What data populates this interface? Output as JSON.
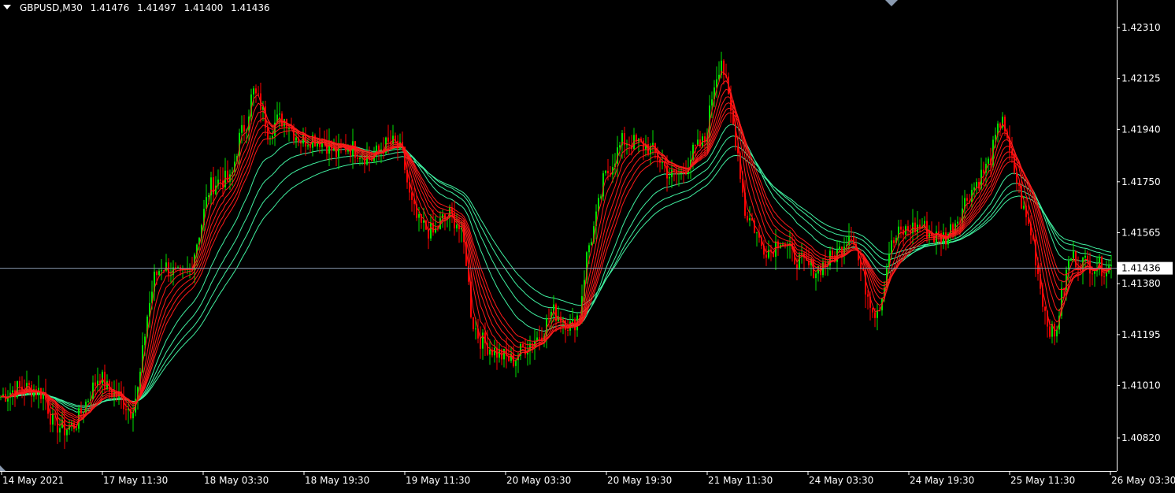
{
  "header": {
    "symbol": "GBPUSD,M30",
    "open": "1.41476",
    "high": "1.41497",
    "low": "1.41400",
    "close": "1.41436"
  },
  "colors": {
    "background": "#000000",
    "axis": "#ffffff",
    "bull_candle": "#00e000",
    "bear_candle": "#ff0000",
    "fast_ma": "#ff1a1a",
    "slow_ma": "#40f0a0",
    "current_price_line": "#8a9ab0"
  },
  "chart_data": {
    "type": "candlestick",
    "y_range": [
      1.407,
      1.4241
    ],
    "y_ticks": [
      "1.42310",
      "1.42125",
      "1.41940",
      "1.41750",
      "1.41565",
      "1.41380",
      "1.41195",
      "1.41010",
      "1.40820"
    ],
    "x_ticks": [
      "14 May 2021",
      "17 May 11:30",
      "18 May 03:30",
      "18 May 19:30",
      "19 May 11:30",
      "20 May 03:30",
      "20 May 19:30",
      "21 May 11:30",
      "24 May 03:30",
      "24 May 19:30",
      "25 May 11:30",
      "26 May 03:30"
    ],
    "current_price": "1.41436",
    "price_path": [
      [
        0,
        1.4097
      ],
      [
        20,
        1.41
      ],
      [
        40,
        1.41
      ],
      [
        55,
        1.4098
      ],
      [
        65,
        1.4088
      ],
      [
        80,
        1.4085
      ],
      [
        95,
        1.4087
      ],
      [
        110,
        1.4096
      ],
      [
        125,
        1.4105
      ],
      [
        135,
        1.41
      ],
      [
        150,
        1.4097
      ],
      [
        165,
        1.4092
      ],
      [
        175,
        1.41
      ],
      [
        185,
        1.4125
      ],
      [
        195,
        1.414
      ],
      [
        205,
        1.4145
      ],
      [
        215,
        1.4143
      ],
      [
        228,
        1.414
      ],
      [
        240,
        1.4143
      ],
      [
        255,
        1.416
      ],
      [
        265,
        1.4173
      ],
      [
        280,
        1.4176
      ],
      [
        292,
        1.4175
      ],
      [
        302,
        1.419
      ],
      [
        312,
        1.4197
      ],
      [
        320,
        1.4208
      ],
      [
        330,
        1.4203
      ],
      [
        340,
        1.4193
      ],
      [
        350,
        1.4197
      ],
      [
        362,
        1.4198
      ],
      [
        372,
        1.4193
      ],
      [
        382,
        1.419
      ],
      [
        395,
        1.4191
      ],
      [
        410,
        1.419
      ],
      [
        425,
        1.4185
      ],
      [
        440,
        1.4188
      ],
      [
        455,
        1.4186
      ],
      [
        470,
        1.4183
      ],
      [
        485,
        1.4188
      ],
      [
        500,
        1.4189
      ],
      [
        510,
        1.4185
      ],
      [
        520,
        1.4168
      ],
      [
        530,
        1.416
      ],
      [
        540,
        1.4158
      ],
      [
        550,
        1.4156
      ],
      [
        560,
        1.4161
      ],
      [
        570,
        1.4163
      ],
      [
        580,
        1.416
      ],
      [
        590,
        1.415
      ],
      [
        598,
        1.4125
      ],
      [
        608,
        1.4118
      ],
      [
        620,
        1.4115
      ],
      [
        635,
        1.4112
      ],
      [
        650,
        1.411
      ],
      [
        665,
        1.4115
      ],
      [
        680,
        1.4118
      ],
      [
        690,
        1.4122
      ],
      [
        700,
        1.4128
      ],
      [
        712,
        1.4126
      ],
      [
        725,
        1.4122
      ],
      [
        735,
        1.4128
      ],
      [
        745,
        1.415
      ],
      [
        755,
        1.416
      ],
      [
        765,
        1.4175
      ],
      [
        778,
        1.4183
      ],
      [
        790,
        1.419
      ],
      [
        805,
        1.4189
      ],
      [
        820,
        1.4188
      ],
      [
        835,
        1.4184
      ],
      [
        850,
        1.4177
      ],
      [
        865,
        1.4178
      ],
      [
        880,
        1.4186
      ],
      [
        895,
        1.419
      ],
      [
        905,
        1.421
      ],
      [
        915,
        1.422
      ],
      [
        925,
        1.4203
      ],
      [
        935,
        1.4188
      ],
      [
        945,
        1.4164
      ],
      [
        955,
        1.416
      ],
      [
        965,
        1.4152
      ],
      [
        978,
        1.415
      ],
      [
        990,
        1.4155
      ],
      [
        1005,
        1.4148
      ],
      [
        1020,
        1.4145
      ],
      [
        1035,
        1.4143
      ],
      [
        1050,
        1.4146
      ],
      [
        1065,
        1.415
      ],
      [
        1080,
        1.4158
      ],
      [
        1090,
        1.4145
      ],
      [
        1100,
        1.4135
      ],
      [
        1110,
        1.4128
      ],
      [
        1118,
        1.4132
      ],
      [
        1128,
        1.415
      ],
      [
        1140,
        1.4156
      ],
      [
        1155,
        1.4158
      ],
      [
        1170,
        1.4159
      ],
      [
        1185,
        1.4155
      ],
      [
        1200,
        1.4155
      ],
      [
        1215,
        1.4162
      ],
      [
        1228,
        1.417
      ],
      [
        1240,
        1.4175
      ],
      [
        1255,
        1.4182
      ],
      [
        1265,
        1.4192
      ],
      [
        1272,
        1.42
      ],
      [
        1278,
        1.4188
      ],
      [
        1288,
        1.4178
      ],
      [
        1298,
        1.4165
      ],
      [
        1310,
        1.4155
      ],
      [
        1318,
        1.414
      ],
      [
        1328,
        1.4125
      ],
      [
        1338,
        1.4118
      ],
      [
        1348,
        1.4135
      ],
      [
        1358,
        1.4148
      ],
      [
        1370,
        1.4146
      ],
      [
        1385,
        1.4145
      ],
      [
        1400,
        1.4144
      ],
      [
        1410,
        1.4144
      ]
    ],
    "moving_averages": {
      "fast_periods": [
        3,
        6,
        9,
        12,
        15,
        18,
        21
      ],
      "slow_periods": [
        30,
        40,
        50,
        60
      ]
    }
  }
}
